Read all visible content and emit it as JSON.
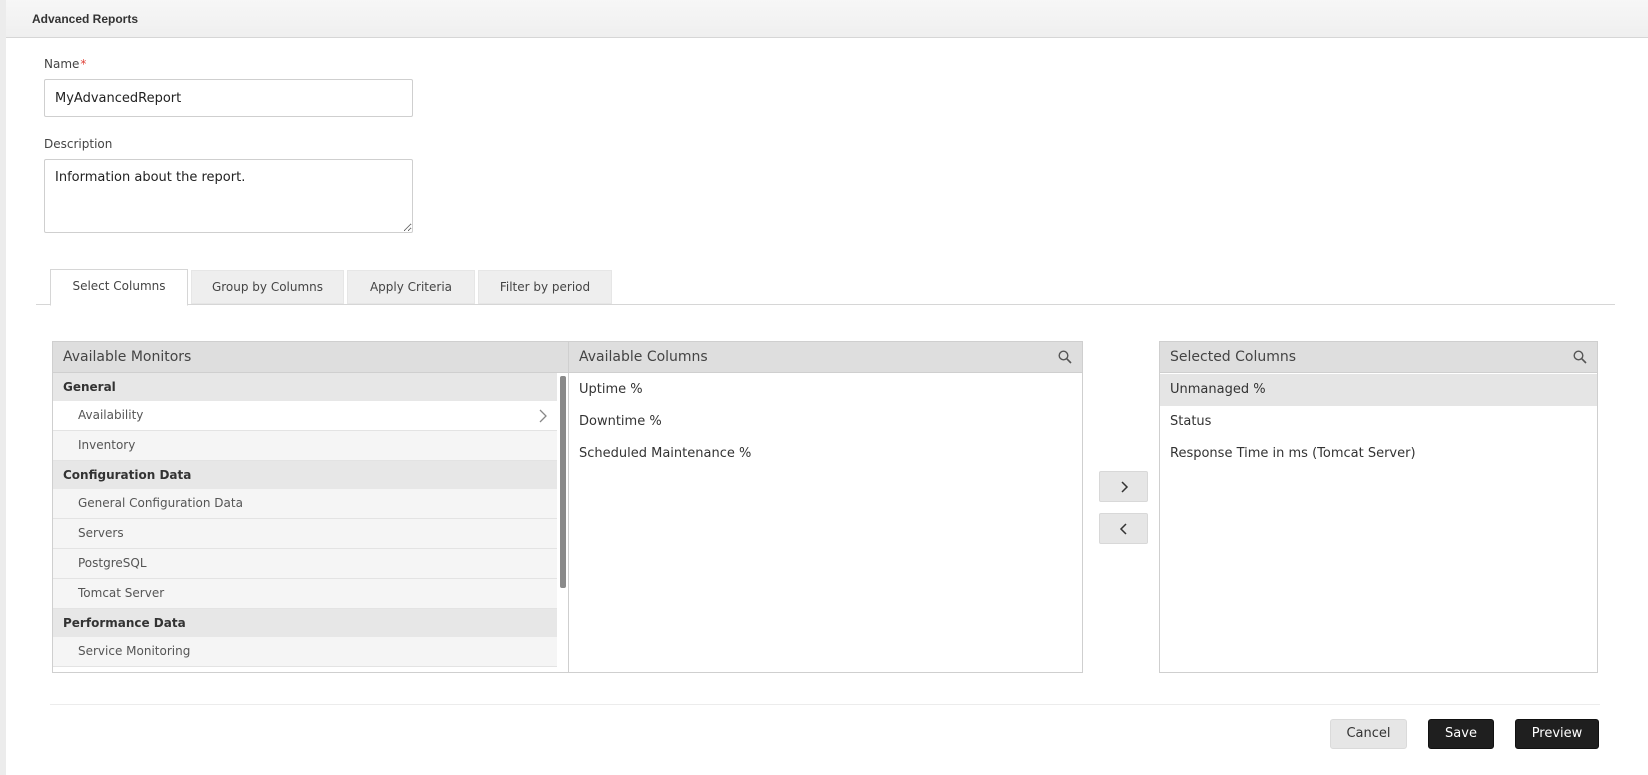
{
  "header": {
    "title": "Advanced Reports"
  },
  "form": {
    "name_label": "Name",
    "name_required_mark": "*",
    "name_value": "MyAdvancedReport",
    "description_label": "Description",
    "description_value": "Information about the report."
  },
  "tabs": [
    {
      "label": "Select Columns",
      "active": true
    },
    {
      "label": "Group by Columns",
      "active": false
    },
    {
      "label": "Apply Criteria",
      "active": false
    },
    {
      "label": "Filter by period",
      "active": false
    }
  ],
  "available_monitors": {
    "title": "Available Monitors",
    "groups": [
      {
        "label": "General",
        "items": [
          "Availability",
          "Inventory"
        ]
      },
      {
        "label": "Configuration Data",
        "items": [
          "General Configuration Data",
          "Servers",
          "PostgreSQL",
          "Tomcat Server"
        ]
      },
      {
        "label": "Performance Data",
        "items": [
          "Service Monitoring"
        ]
      }
    ],
    "selected_item": "Availability"
  },
  "available_columns": {
    "title": "Available Columns",
    "items": [
      "Uptime %",
      "Downtime %",
      "Scheduled Maintenance %"
    ]
  },
  "selected_columns": {
    "title": "Selected Columns",
    "items": [
      "Unmanaged %",
      "Status",
      "Response Time in ms (Tomcat Server)"
    ],
    "highlighted_item": "Unmanaged %"
  },
  "move": {
    "add_icon": "chevron-right-icon",
    "remove_icon": "chevron-left-icon"
  },
  "footer": {
    "cancel_label": "Cancel",
    "save_label": "Save",
    "preview_label": "Preview"
  }
}
